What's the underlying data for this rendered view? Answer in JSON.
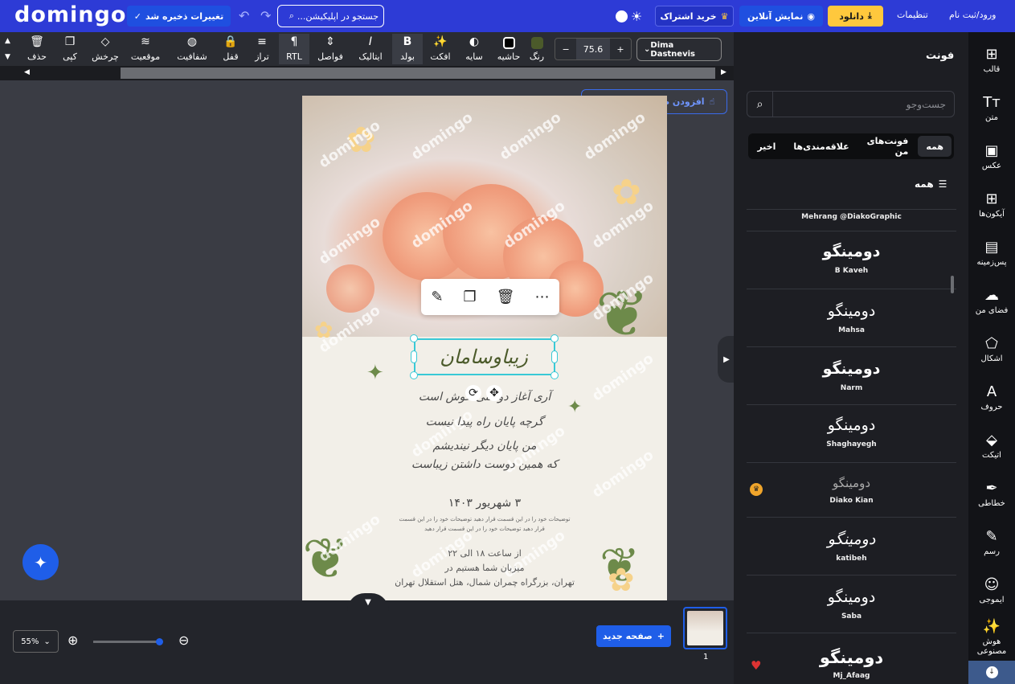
{
  "topbar": {
    "logo": "domingo",
    "save_label": "تغییرات ذخیره شد",
    "search_placeholder": "جستجو در اپلیکیشن...",
    "subscribe_label": "خرید اشتراک",
    "live_label": "نمایش آنلاین",
    "download_label": "دانلود",
    "settings_label": "تنظیمات",
    "login_label": "ورود/ثبت نام"
  },
  "toolbar": {
    "delete": "حذف",
    "copy": "کپی",
    "rotate": "چرخش",
    "position": "موقعیت",
    "opacity": "شفافیت",
    "lock": "قفل",
    "align": "تراز",
    "rtl": "RTL",
    "spacing": "فواصل",
    "italic": "ایتالیک",
    "bold": "بولد",
    "effect": "افکت",
    "shadow": "سایه",
    "border": "حاشیه",
    "color": "رنگ",
    "font_size": "75.6",
    "font_name": "Dima Dastnevis",
    "text_color": "#4b5a2a"
  },
  "canvas": {
    "add_design_label": "افزودن طرح به سبد خرید",
    "watermark": "domingo",
    "title": "زیباوسامان",
    "lines": [
      "آری آغاز دوستی خوش است",
      "گرچه پایان راه پیدا نیست",
      "من پایان دیگر نیندیشم",
      "که همین دوست داشتن زیباست"
    ],
    "date": "۳ شهریور ۱۴۰۳",
    "desc_1": "توضیحات خود را در این قسمت قرار دهید توضیحات خود را در این قسمت",
    "desc_2": "قرار دهید توضیحات خود را در این قسمت قرار دهید",
    "time": "از ساعت ۱۸ الی ۲۲",
    "host": "میزبان شما هستیم در",
    "venue": "تهران، بزرگراه چمران شمال، هتل استقلال تهران"
  },
  "bottom": {
    "zoom": "55%",
    "new_page_label": "صفحه جدید",
    "page_number": "1"
  },
  "panel": {
    "title": "فونت",
    "search_placeholder": "جست‌وجو",
    "tabs": [
      "همه",
      "فونت‌های من",
      "علاقه‌مندی‌ها",
      "اخیر"
    ],
    "all_heading": "همه",
    "fonts": [
      {
        "sample": "",
        "name": "Mehrang @DiakoGraphic"
      },
      {
        "sample": "دومینگو",
        "name": "B Kaveh"
      },
      {
        "sample": "دومینگو",
        "name": "Mahsa"
      },
      {
        "sample": "دومینگو",
        "name": "Narm"
      },
      {
        "sample": "دومینگو",
        "name": "Shaghayegh"
      },
      {
        "sample": "دومینگو",
        "name": "Diako Kian"
      },
      {
        "sample": "دومینگو",
        "name": "katibeh"
      },
      {
        "sample": "دومینگو",
        "name": "Saba"
      },
      {
        "sample": "دومینگو",
        "name": "Mj_Afaag"
      }
    ]
  },
  "nav": {
    "items": [
      "قالب",
      "متن",
      "عکس",
      "آیکون‌ها",
      "پس‌زمینه",
      "فضای من",
      "اشکال",
      "حروف",
      "اتیکت",
      "خطاطی",
      "رسم",
      "ایموجی",
      "هوش مصنوعی"
    ]
  }
}
